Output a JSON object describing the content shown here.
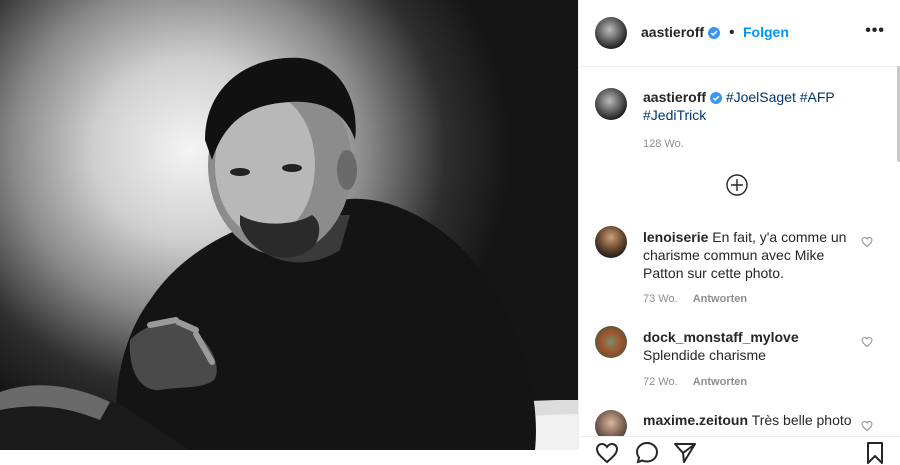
{
  "post": {
    "username": "aastieroff",
    "follow_label": "Folgen",
    "more_label": "•••"
  },
  "caption": {
    "username": "aastieroff",
    "tags": "#JoelSaget #AFP #JediTrick",
    "time": "128 Wo."
  },
  "comments": [
    {
      "username": "lenoiserie",
      "text": "En fait, y'a comme un charisme commun avec Mike Patton sur cette photo.",
      "time": "73 Wo.",
      "reply_label": "Antworten"
    },
    {
      "username": "dock_monstaff_mylove",
      "text": "Splendide charisme",
      "time": "72 Wo.",
      "reply_label": "Antworten"
    },
    {
      "username": "maxime.zeitoun",
      "text": "Très belle photo",
      "time": "",
      "reply_label": ""
    }
  ],
  "icons": [
    "verified-badge-icon",
    "more-options-icon",
    "load-more-comments-icon",
    "like-comment-icon",
    "heart-icon",
    "comment-icon",
    "share-icon",
    "save-icon"
  ],
  "colors": {
    "accent": "#0095f6",
    "hashtag": "#00376b",
    "muted": "#8e8e8e"
  }
}
